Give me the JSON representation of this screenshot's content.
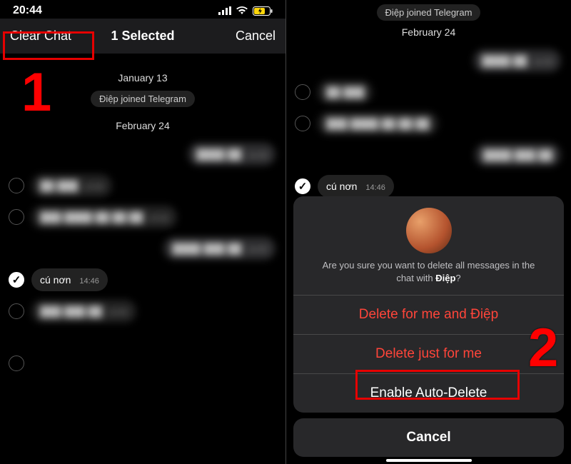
{
  "status": {
    "time": "20:44"
  },
  "selection_header": {
    "clear": "Clear Chat",
    "title": "1 Selected",
    "cancel": "Cancel"
  },
  "dates": {
    "jan": "January 13",
    "feb": "February 24"
  },
  "system_pill": "Điệp joined Telegram",
  "selected_msg": {
    "text": "cú nơn",
    "time": "14:46"
  },
  "dialog": {
    "confirm_prefix": "Are you sure you want to delete all messages in the chat with ",
    "contact": "Điệp",
    "confirm_suffix": "?",
    "delete_both": "Delete for me and Điệp",
    "delete_me": "Delete just for me",
    "auto_delete": "Enable Auto-Delete",
    "cancel": "Cancel"
  },
  "steps": {
    "one": "1",
    "two": "2"
  }
}
